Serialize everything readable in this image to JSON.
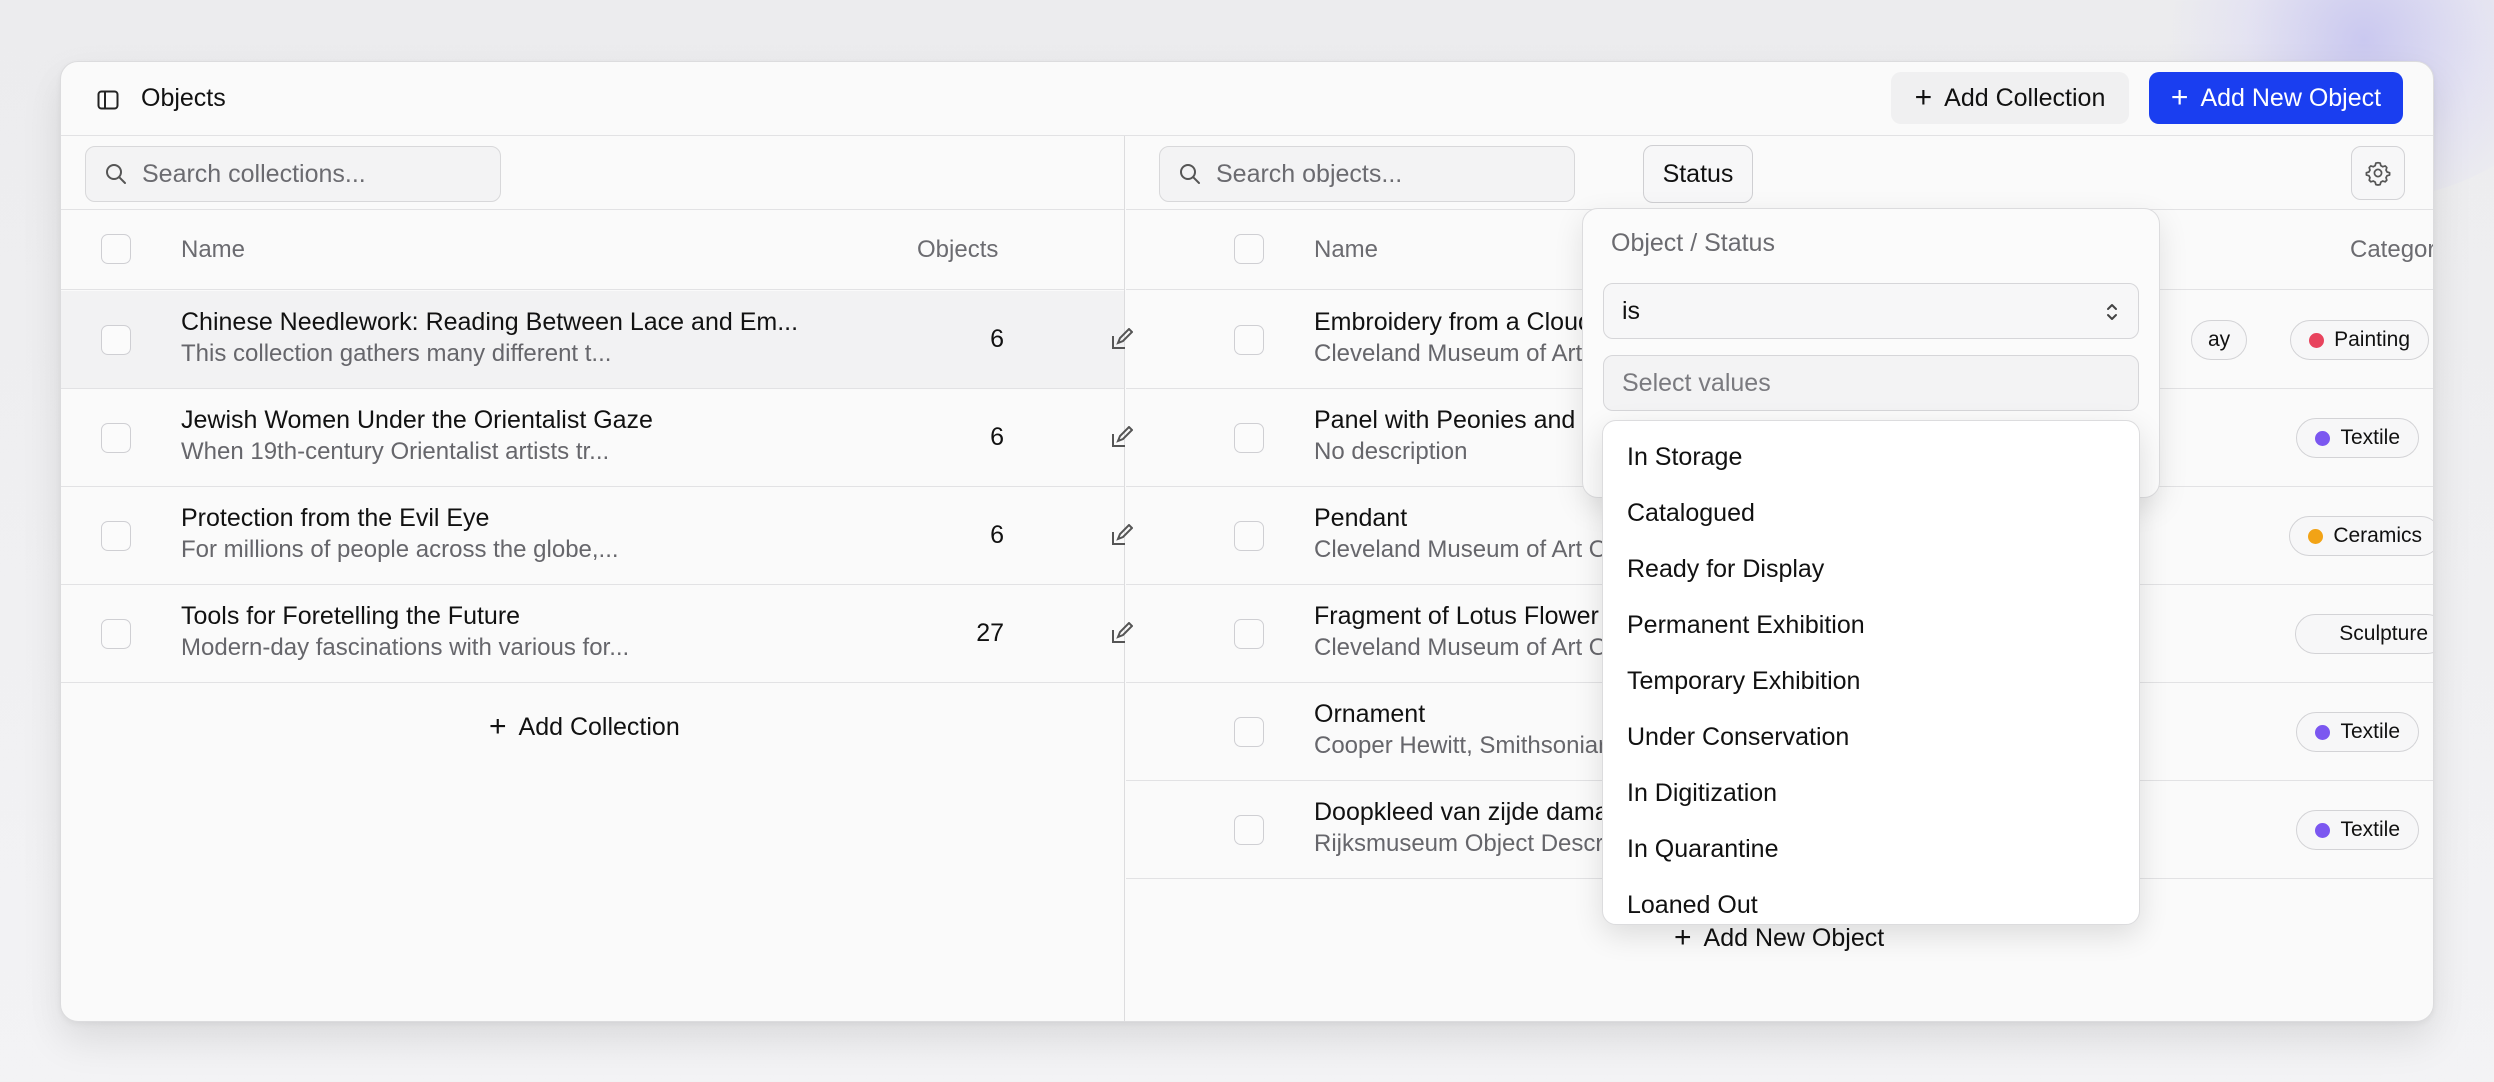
{
  "header": {
    "title": "Objects",
    "add_collection_label": "Add Collection",
    "add_object_label": "Add New Object"
  },
  "collections": {
    "search_placeholder": "Search collections...",
    "columns": {
      "name": "Name",
      "objects": "Objects"
    },
    "rows": [
      {
        "title": "Chinese Needlework: Reading Between Lace and Em...",
        "description": "This collection gathers many different t...",
        "count": "6"
      },
      {
        "title": "Jewish Women Under the Orientalist Gaze",
        "description": "When 19th-century Orientalist artists tr...",
        "count": "6"
      },
      {
        "title": "Protection from the Evil Eye",
        "description": "For millions of people across the globe,...",
        "count": "6"
      },
      {
        "title": "Tools for Foretelling the Future",
        "description": "Modern-day fascinations with various for...",
        "count": "27"
      }
    ],
    "add_label": "Add Collection"
  },
  "objects": {
    "search_placeholder": "Search objects...",
    "status_filter_label": "Status",
    "columns": {
      "name": "Name",
      "categories": "Categories"
    },
    "rows": [
      {
        "title": "Embroidery from a Cloud Col",
        "description": "Cleveland Museum of Art Obj",
        "status_partial": "ay",
        "category": "Painting",
        "category_color": "#e8435d"
      },
      {
        "title": "Panel with Peonies and Butte",
        "description": "No description",
        "category": "Textile",
        "category_color": "#7b57f0"
      },
      {
        "title": "Pendant",
        "description": "Cleveland Museum of Art Obje",
        "category": "Ceramics",
        "category_color": "#f2a316"
      },
      {
        "title": "Fragment of Lotus Flower",
        "description": "Cleveland Museum of Art Obje",
        "category": "Sculpture",
        "category_color": ""
      },
      {
        "title": "Ornament",
        "description": "Cooper Hewitt, Smithsonian De",
        "category": "Textile",
        "category_color": "#7b57f0"
      },
      {
        "title": "Doopkleed van zijde damast m",
        "description": "Rijksmuseum Object Descriptio",
        "category": "Textile",
        "category_color": "#7b57f0"
      }
    ],
    "add_label": "Add New Object"
  },
  "filter": {
    "field_label": "Object / Status",
    "operator": "is",
    "values_placeholder": "Select values",
    "options": [
      "In Storage",
      "Catalogued",
      "Ready for Display",
      "Permanent Exhibition",
      "Temporary Exhibition",
      "Under Conservation",
      "In Digitization",
      "In Quarantine",
      "Loaned Out"
    ]
  }
}
